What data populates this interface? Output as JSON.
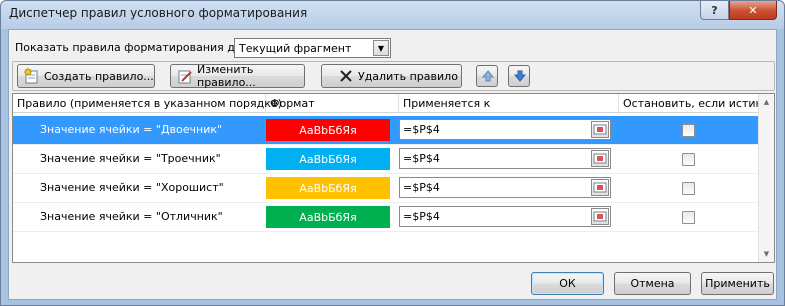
{
  "window": {
    "title": "Диспетчер правил условного форматирования",
    "help_label": "?",
    "close_label": "✕"
  },
  "show_rules": {
    "label": "Показать правила форматирования для:",
    "selected": "Текущий фрагмент"
  },
  "toolbar": {
    "create_label": "Создать правило...",
    "edit_label": "Изменить правило...",
    "delete_label": "Удалить правило"
  },
  "grid": {
    "columns": [
      "Правило (применяется в указанном порядке)",
      "Формат",
      "Применяется к",
      "Остановить, если истина"
    ],
    "rows": [
      {
        "rule": "Значение ячейки = \"Двоечник\"",
        "preview": "AaBbБбЯя",
        "color": "#ff0000",
        "applies": "=$P$4",
        "stop": false,
        "selected": true
      },
      {
        "rule": "Значение ячейки = \"Троечник\"",
        "preview": "AaBbБбЯя",
        "color": "#00b0f0",
        "applies": "=$P$4",
        "stop": false,
        "selected": false
      },
      {
        "rule": "Значение ячейки = \"Хорошист\"",
        "preview": "AaBbБбЯя",
        "color": "#ffc000",
        "applies": "=$P$4",
        "stop": false,
        "selected": false
      },
      {
        "rule": "Значение ячейки = \"Отличник\"",
        "preview": "AaBbБбЯя",
        "color": "#00b050",
        "applies": "=$P$4",
        "stop": false,
        "selected": false
      }
    ]
  },
  "buttons": {
    "ok": "ОК",
    "cancel": "Отмена",
    "apply": "Применить"
  }
}
